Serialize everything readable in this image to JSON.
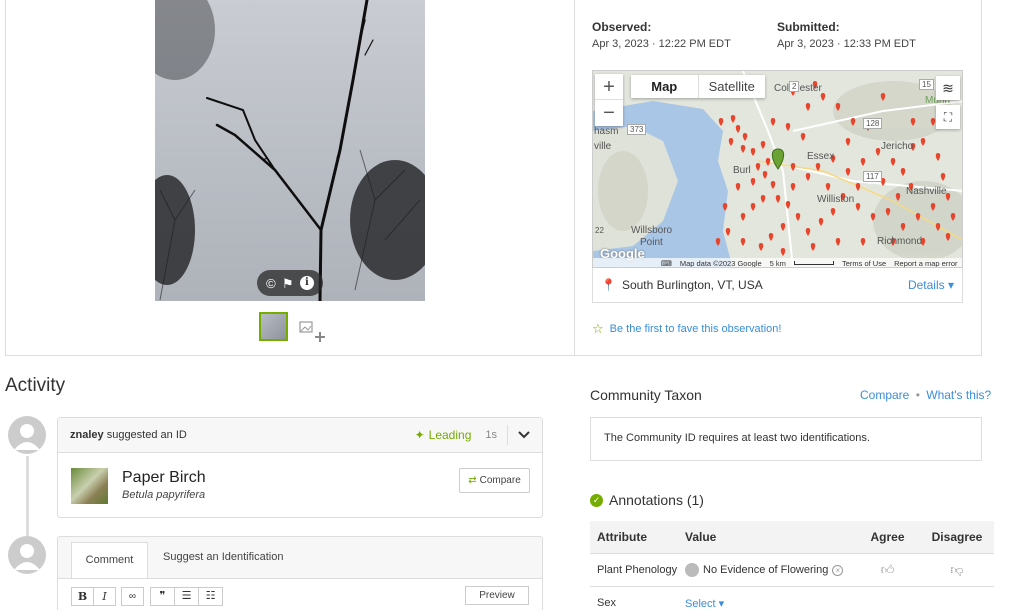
{
  "observation": {
    "observed_label": "Observed:",
    "observed_date": "Apr 3, 2023 · 12:22 PM EDT",
    "submitted_label": "Submitted:",
    "submitted_date": "Apr 3, 2023 · 12:33 PM EDT"
  },
  "map": {
    "zoom_in": "+",
    "zoom_out": "−",
    "type_map": "Map",
    "type_satellite": "Satellite",
    "footer_data": "Map data ©2023 Google",
    "footer_scale": "5 km",
    "footer_terms": "Terms of Use",
    "footer_report": "Report a map error",
    "logo": "Google",
    "places": {
      "colchester": "Colchester",
      "essex": "Essex",
      "jericho": "Jericho",
      "nashville": "Nashville",
      "williston": "Williston",
      "willsboro": "Willsboro",
      "point": "Point",
      "richmond": "Richmond",
      "burlington": "Burl",
      "hasm": "hasm",
      "ville": "ville",
      "r373": "373",
      "r128": "128",
      "r117": "117",
      "r2": "2",
      "r15": "15",
      "r22": "22",
      "munnn": "Munn"
    },
    "pin_color": "#e8452c",
    "marker_color": "#6aa334"
  },
  "location": {
    "text": "South Burlington, VT, USA",
    "details": "Details ▾"
  },
  "fave": "Be the first to fave this observation!",
  "activity": {
    "title": "Activity",
    "identification": {
      "user": "znaley",
      "action": "suggested an ID",
      "status": "Leading",
      "age": "1s",
      "common_name": "Paper Birch",
      "scientific_name": "Betula papyrifera",
      "compare": "Compare"
    },
    "comment": {
      "tab_comment": "Comment",
      "tab_suggest": "Suggest an Identification",
      "preview": "Preview",
      "toolbar": {
        "bold": "B",
        "italic": "I",
        "link": "∞",
        "quote": "❞",
        "ul": "☰",
        "ol": "☷"
      }
    }
  },
  "community": {
    "title": "Community Taxon",
    "compare": "Compare",
    "whats_this": "What's this?",
    "message": "The Community ID requires at least two identifications."
  },
  "annotations": {
    "title": "Annotations (1)",
    "headers": {
      "attribute": "Attribute",
      "value": "Value",
      "agree": "Agree",
      "disagree": "Disagree"
    },
    "rows": [
      {
        "attribute": "Plant Phenology",
        "value": "No Evidence of Flowering"
      },
      {
        "attribute": "Sex",
        "value": "Select ▾"
      }
    ]
  },
  "colors": {
    "accent_green": "#74ac00",
    "link_blue": "#3a8edb"
  }
}
